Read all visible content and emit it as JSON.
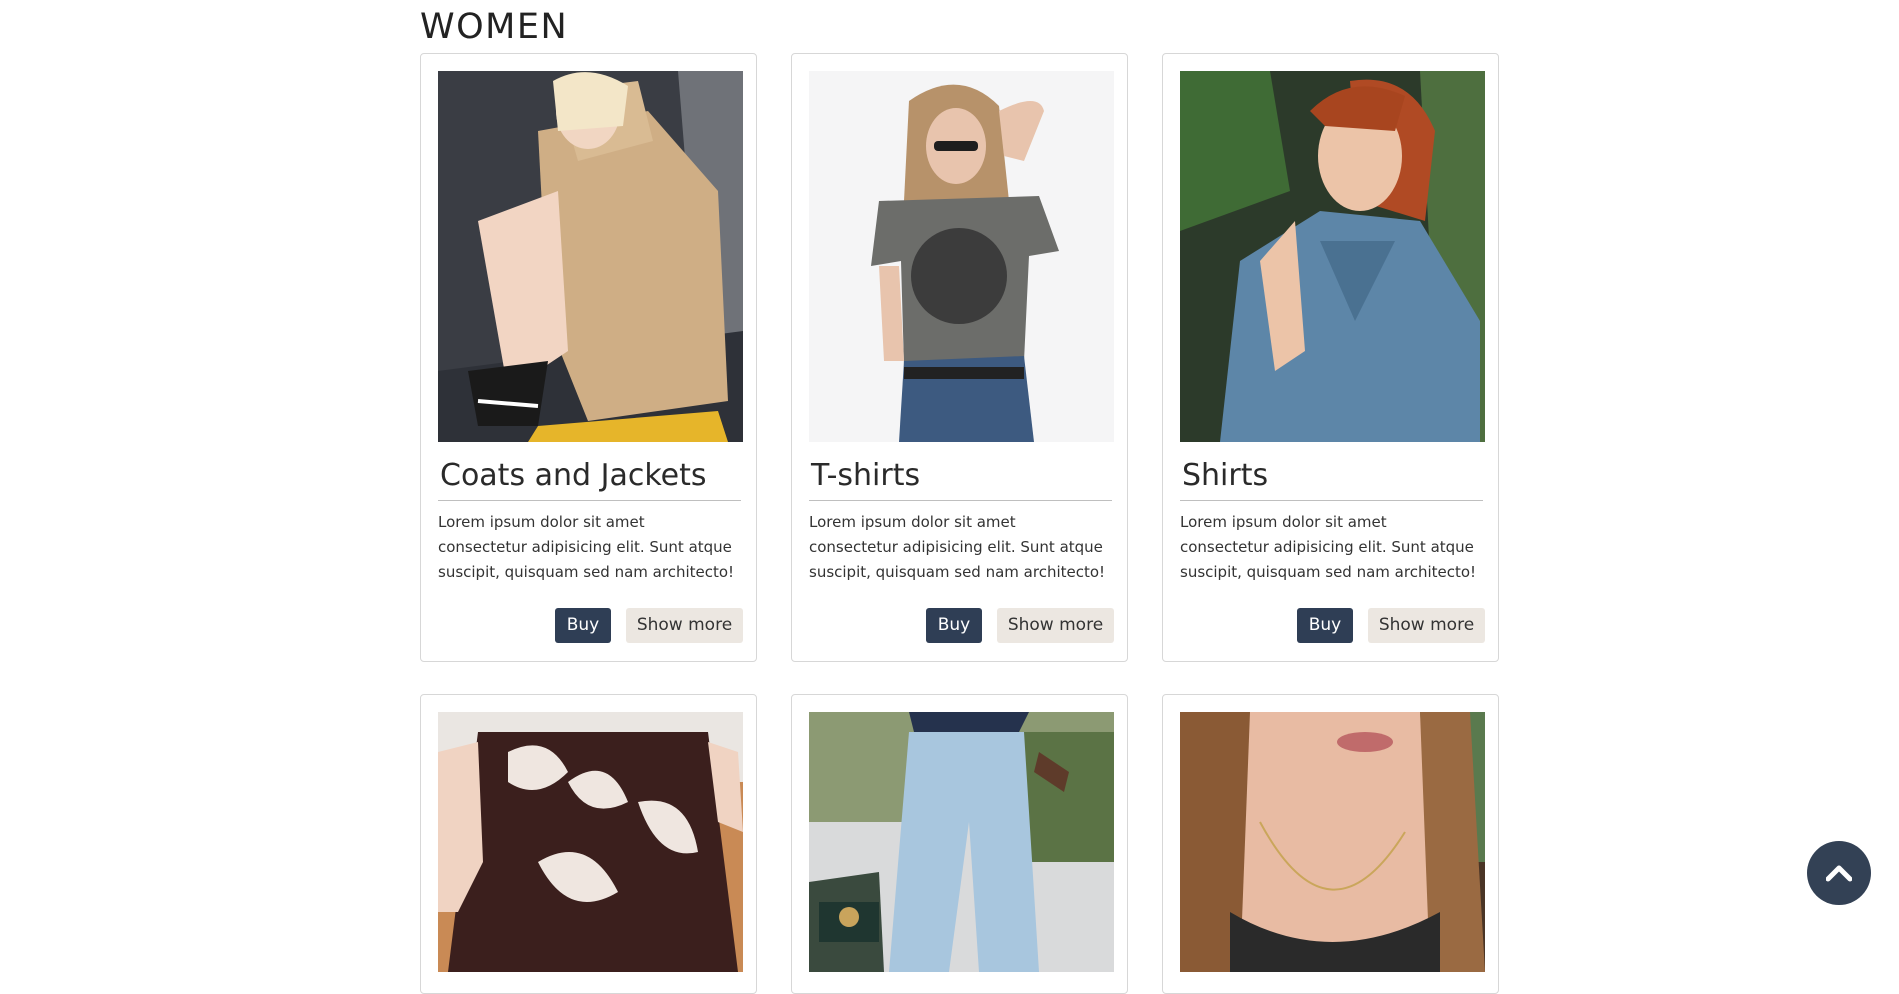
{
  "section": {
    "title": "WOMEN"
  },
  "cards": [
    {
      "title": "Coats and Jackets",
      "description": "Lorem ipsum dolor sit amet consectetur adipisicing elit. Sunt atque suscipit, quisquam sed nam architecto!",
      "buy_label": "Buy",
      "more_label": "Show more",
      "image_alt": "woman-in-beige-fur-coat-photo"
    },
    {
      "title": "T-shirts",
      "description": "Lorem ipsum dolor sit amet consectetur adipisicing elit. Sunt atque suscipit, quisquam sed nam architecto!",
      "buy_label": "Buy",
      "more_label": "Show more",
      "image_alt": "woman-in-gray-tshirt-photo"
    },
    {
      "title": "Shirts",
      "description": "Lorem ipsum dolor sit amet consectetur adipisicing elit. Sunt atque suscipit, quisquam sed nam architecto!",
      "buy_label": "Buy",
      "more_label": "Show more",
      "image_alt": "woman-in-denim-shirt-photo"
    },
    {
      "image_alt": "woman-in-floral-skirt-photo"
    },
    {
      "image_alt": "woman-in-ripped-jeans-photo"
    },
    {
      "image_alt": "woman-with-necklace-photo"
    }
  ],
  "scroll_top": {
    "icon": "chevron-up-icon"
  },
  "colors": {
    "buy_button": "#2f3e55",
    "show_more_button": "#ece7e1",
    "scroll_top_button": "#334155",
    "card_border": "#d7d7d7"
  }
}
